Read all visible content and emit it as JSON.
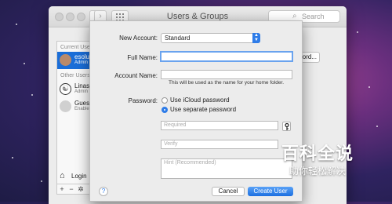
{
  "window": {
    "title": "Users & Groups",
    "search_placeholder": "Search",
    "back_glyph": "‹",
    "forward_glyph": "›"
  },
  "sidebar": {
    "current_user_header": "Current User",
    "other_users_header": "Other Users",
    "users": [
      {
        "name": "esolu",
        "role": "Admin",
        "selected": true
      },
      {
        "name": "Linas",
        "role": "Admin",
        "selected": false
      },
      {
        "name": "Gues",
        "role": "Enable",
        "selected": false
      }
    ],
    "login_label": "Login",
    "add_glyph": "+",
    "remove_glyph": "−",
    "gear_glyph": "✲"
  },
  "behind_button_label": "ord...",
  "sheet": {
    "new_account_label": "New Account:",
    "new_account_value": "Standard",
    "full_name_label": "Full Name:",
    "full_name_value": "",
    "account_name_label": "Account Name:",
    "account_name_value": "",
    "account_name_hint": "This will be used as the name for your home folder.",
    "password_label": "Password:",
    "password_options": [
      {
        "label": "Use iCloud password",
        "selected": false
      },
      {
        "label": "Use separate password",
        "selected": true
      }
    ],
    "required_placeholder": "Required",
    "verify_placeholder": "Verify",
    "hint_placeholder": "Hint (Recommended)",
    "help_glyph": "?",
    "cancel_label": "Cancel",
    "create_label": "Create User"
  },
  "watermark": {
    "title": "百科全说",
    "subtitle": "助你轻松解决"
  },
  "colors": {
    "accent": "#2e7ce8",
    "selection": "#1a6ed8"
  }
}
